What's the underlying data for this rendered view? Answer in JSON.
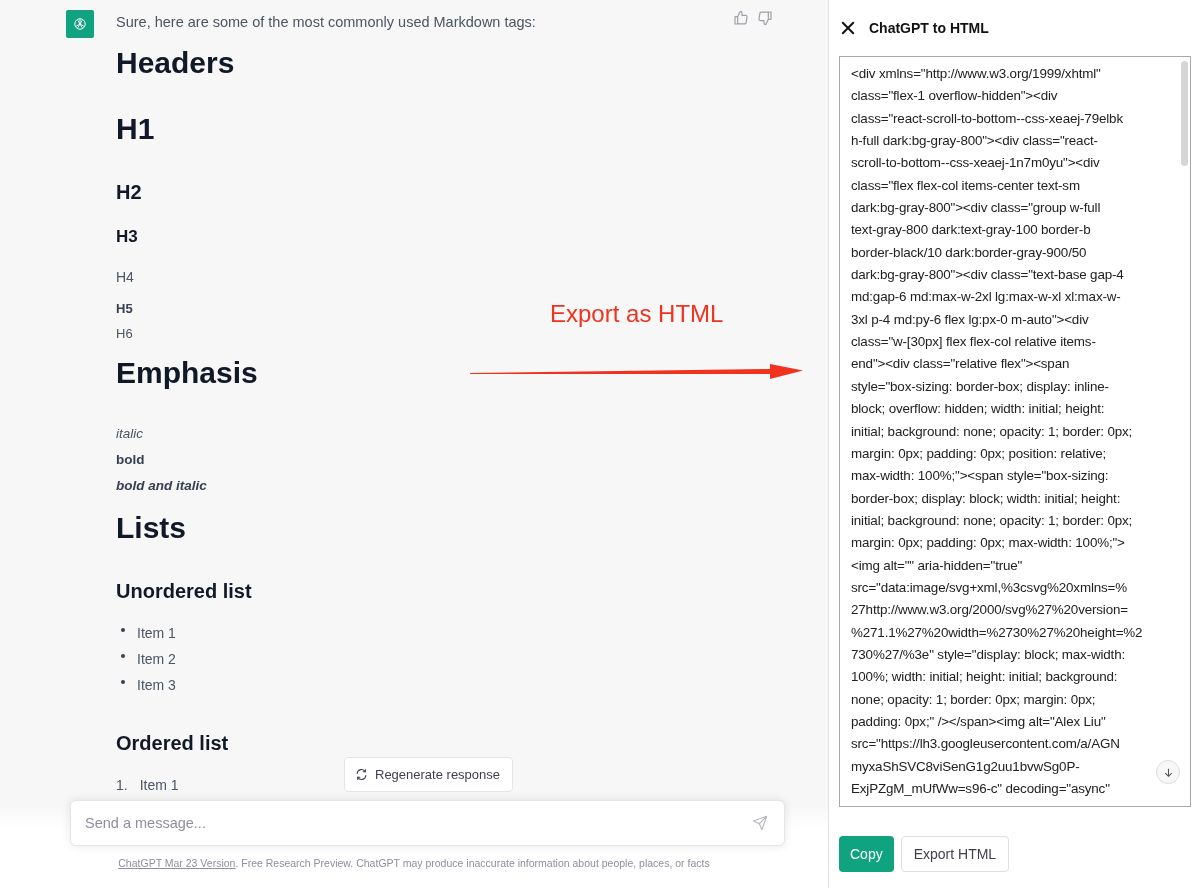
{
  "message": {
    "intro": "Sure, here are some of the most commonly used Markdown tags:",
    "blocks": [
      {
        "kind": "h1",
        "text": "Headers"
      },
      {
        "kind": "h1",
        "text": "H1"
      },
      {
        "kind": "h2",
        "text": "H2"
      },
      {
        "kind": "h3",
        "text": "H3"
      },
      {
        "kind": "h4",
        "text": "H4"
      },
      {
        "kind": "h5",
        "text": "H5"
      },
      {
        "kind": "h6",
        "text": "H6"
      },
      {
        "kind": "h1",
        "text": "Emphasis"
      },
      {
        "kind": "italic",
        "text": "italic"
      },
      {
        "kind": "bold",
        "text": "bold"
      },
      {
        "kind": "bold_italic",
        "text": "bold and italic"
      },
      {
        "kind": "h1",
        "text": "Lists"
      },
      {
        "kind": "h2",
        "text": "Unordered list"
      },
      {
        "kind": "bullet_list",
        "items": [
          "Item 1",
          "Item 2",
          "Item 3"
        ]
      },
      {
        "kind": "h2",
        "text": "Ordered list"
      },
      {
        "kind": "ordered_list",
        "items": [
          {
            "number": "1.",
            "text": "Item 1"
          }
        ]
      }
    ]
  },
  "regenerate_button": "Regenerate response",
  "composer": {
    "placeholder": "Send a message..."
  },
  "footer": {
    "link": "ChatGPT Mar 23 Version",
    "text": ". Free Research Preview. ChatGPT may produce inaccurate information about people, places, or facts"
  },
  "annotation": {
    "text": "Export as HTML"
  },
  "panel": {
    "title": "ChatGPT to HTML",
    "code_lines": [
      "<div xmlns=\"http://www.w3.org/1999/xhtml\"",
      "class=\"flex-1 overflow-hidden\"><div",
      "class=\"react-scroll-to-bottom--css-xeaej-79elbk",
      "h-full dark:bg-gray-800\"><div class=\"react-",
      "scroll-to-bottom--css-xeaej-1n7m0yu\"><div",
      "class=\"flex flex-col items-center text-sm",
      "dark:bg-gray-800\"><div class=\"group w-full",
      "text-gray-800 dark:text-gray-100 border-b",
      "border-black/10 dark:border-gray-900/50",
      "dark:bg-gray-800\"><div class=\"text-base gap-4",
      "md:gap-6 md:max-w-2xl lg:max-w-xl xl:max-w-",
      "3xl p-4 md:py-6 flex lg:px-0 m-auto\"><div",
      "class=\"w-[30px] flex flex-col relative items-",
      "end\"><div class=\"relative flex\"><span",
      "style=\"box-sizing: border-box; display: inline-",
      "block; overflow: hidden; width: initial; height:",
      "initial; background: none; opacity: 1; border: 0px;",
      "margin: 0px; padding: 0px; position: relative;",
      "max-width: 100%;\"><span style=\"box-sizing:",
      "border-box; display: block; width: initial; height:",
      "initial; background: none; opacity: 1; border: 0px;",
      "margin: 0px; padding: 0px; max-width: 100%;\">",
      "<img alt=\"\" aria-hidden=\"true\"",
      "src=\"data:image/svg+xml,%3csvg%20xmlns=%",
      "27http://www.w3.org/2000/svg%27%20version=",
      "%271.1%27%20width=%2730%27%20height=%2",
      "730%27/%3e\" style=\"display: block; max-width:",
      "100%; width: initial; height: initial; background:",
      "none; opacity: 1; border: 0px; margin: 0px;",
      "padding: 0px;\" /></span><img alt=\"Alex Liu\"",
      "src=\"https://lh3.googleusercontent.com/a/AGN",
      "myxaShSVC8viSenG1g2uu1bvwSg0P-",
      "ExjPZgM_mUfWw=s96-c\" decoding=\"async\""
    ],
    "buttons": [
      {
        "label": "Copy",
        "kind": "primary"
      },
      {
        "label": "Export HTML",
        "kind": "secondary"
      }
    ]
  }
}
